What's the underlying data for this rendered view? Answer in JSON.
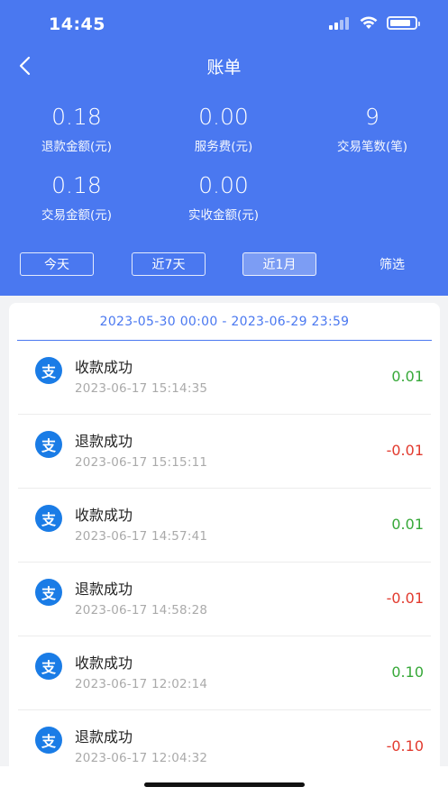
{
  "status": {
    "time": "14:45"
  },
  "nav": {
    "title": "账单"
  },
  "stats": [
    {
      "value": "0.18",
      "label": "退款金额(元)"
    },
    {
      "value": "0.00",
      "label": "服务费(元)"
    },
    {
      "value": "9",
      "label": "交易笔数(笔)"
    },
    {
      "value": "0.18",
      "label": "交易金额(元)"
    },
    {
      "value": "0.00",
      "label": "实收金额(元)"
    }
  ],
  "filters": {
    "today": "今天",
    "week": "近7天",
    "month": "近1月",
    "filter": "筛选",
    "active": "month"
  },
  "range": "2023-05-30 00:00 - 2023-06-29 23:59",
  "transactions": [
    {
      "icon": "支",
      "title": "收款成功",
      "time": "2023-06-17 15:14:35",
      "amount": "0.01",
      "type": "income"
    },
    {
      "icon": "支",
      "title": "退款成功",
      "time": "2023-06-17 15:15:11",
      "amount": "-0.01",
      "type": "refund"
    },
    {
      "icon": "支",
      "title": "收款成功",
      "time": "2023-06-17 14:57:41",
      "amount": "0.01",
      "type": "income"
    },
    {
      "icon": "支",
      "title": "退款成功",
      "time": "2023-06-17 14:58:28",
      "amount": "-0.01",
      "type": "refund"
    },
    {
      "icon": "支",
      "title": "收款成功",
      "time": "2023-06-17 12:02:14",
      "amount": "0.10",
      "type": "income"
    },
    {
      "icon": "支",
      "title": "退款成功",
      "time": "2023-06-17 12:04:32",
      "amount": "-0.10",
      "type": "refund"
    }
  ],
  "colors": {
    "header": "#4a78f0",
    "income": "#36a838",
    "refund": "#e23a2e",
    "alipay": "#1a7ce6"
  }
}
